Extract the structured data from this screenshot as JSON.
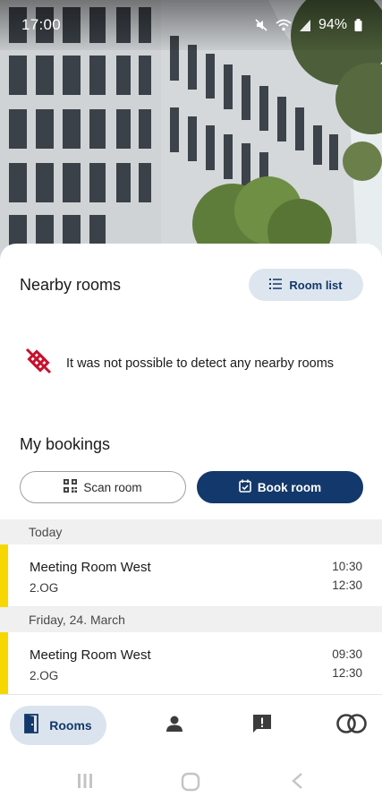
{
  "status_bar": {
    "time": "17:00",
    "battery": "94%",
    "icons": [
      "mute-icon",
      "wifi-icon",
      "signal-icon",
      "battery-icon"
    ]
  },
  "nearby": {
    "title": "Nearby rooms",
    "room_list_label": "Room list",
    "message": "It was not possible to detect any nearby rooms"
  },
  "bookings": {
    "title": "My bookings",
    "scan_label": "Scan room",
    "book_label": "Book room",
    "groups": [
      {
        "day": "Today",
        "items": [
          {
            "room": "Meeting Room West",
            "floor": "2.OG",
            "start": "10:30",
            "end": "12:30"
          }
        ]
      },
      {
        "day": "Friday,  24. March",
        "items": [
          {
            "room": "Meeting Room West",
            "floor": "2.OG",
            "start": "09:30",
            "end": "12:30"
          }
        ]
      }
    ]
  },
  "bottom_nav": {
    "rooms_label": "Rooms",
    "items": [
      "door-icon",
      "person-icon",
      "feedback-icon",
      "brand-logo-icon"
    ]
  },
  "colors": {
    "primary": "#13386b",
    "accent_bar": "#f6d800",
    "chip_bg": "#dde6ee",
    "error_icon": "#c8102e"
  }
}
